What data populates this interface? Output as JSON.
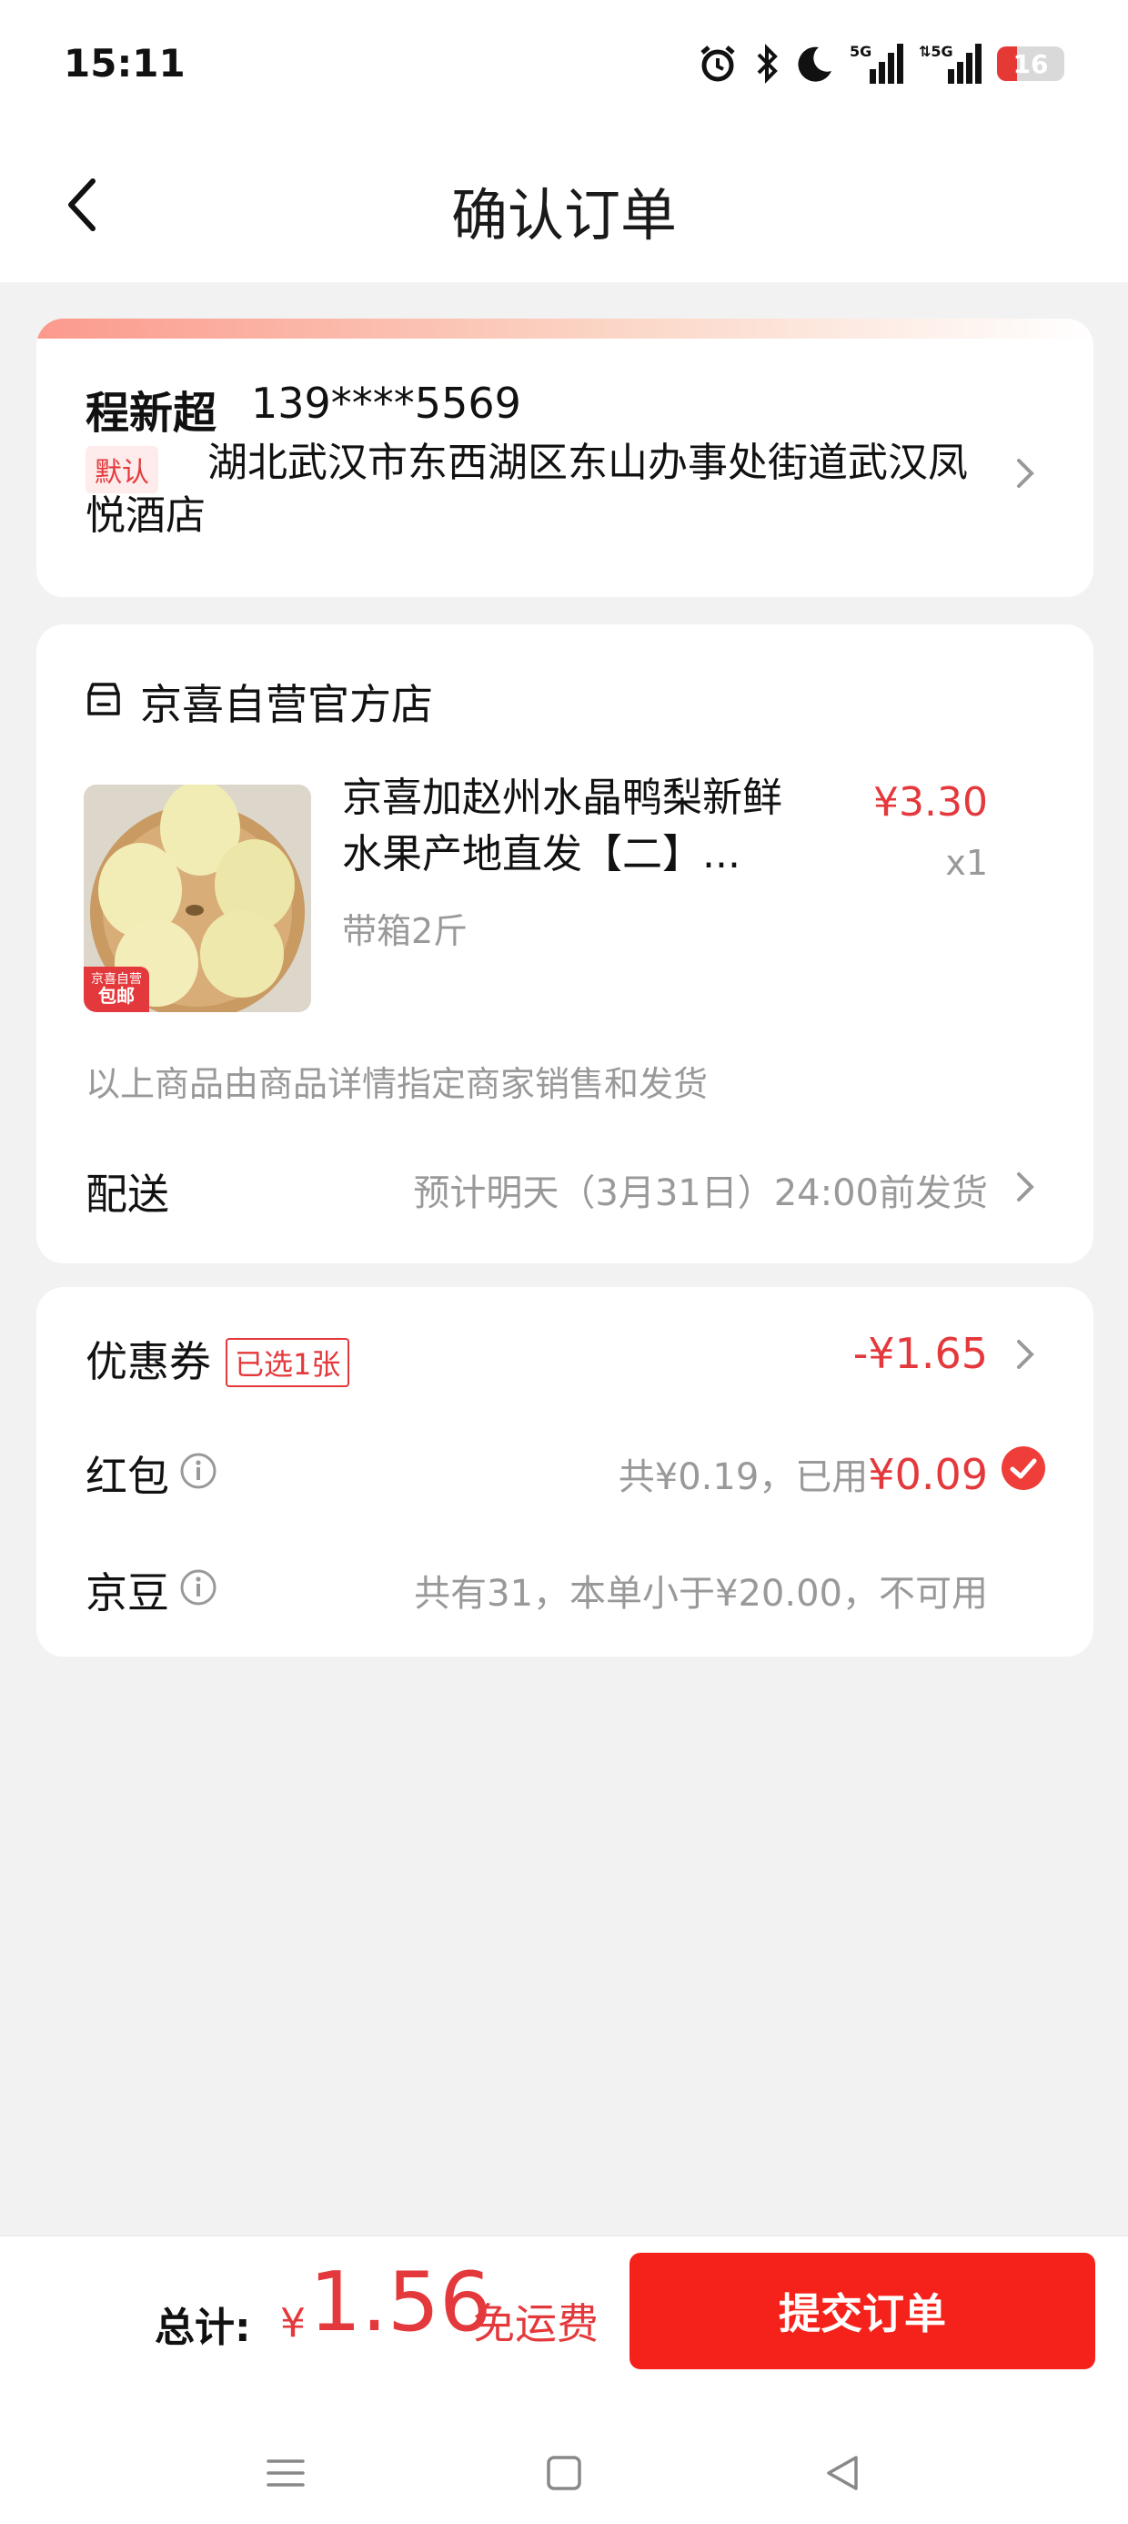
{
  "status_bar": {
    "time": "15:11",
    "battery_level": "16",
    "icons": [
      "alarm-icon",
      "bluetooth-icon",
      "do-not-disturb-icon",
      "5g-signal-icon",
      "5g-signal-icon",
      "battery-icon"
    ]
  },
  "header": {
    "title": "确认订单",
    "back_icon": "chevron-left-icon"
  },
  "address": {
    "name": "程新超",
    "phone": "139****5569",
    "default_tag": "默认",
    "detail": "湖北武汉市东西湖区东山办事处街道武汉凤悦酒店"
  },
  "order": {
    "store_name": "京喜自营官方店",
    "product": {
      "title": "京喜加赵州水晶鸭梨新鲜水果产地直发【二】...",
      "price": "¥3.30",
      "quantity": "x1",
      "spec": "带箱2斤",
      "badge_line1": "京喜自营",
      "badge_line2": "包邮"
    },
    "seller_note": "以上商品由商品详情指定商家销售和发货",
    "delivery_label": "配送",
    "delivery_value": "预计明天（3月31日）24:00前发货"
  },
  "discounts": {
    "coupon_label": "优惠券",
    "coupon_tag": "已选1张",
    "coupon_value": "-¥1.65",
    "hongbao_label": "红包",
    "hongbao_total": "共¥0.19，已用",
    "hongbao_used": "¥0.09",
    "jingdou_label": "京豆",
    "jingdou_summary": "共有31，本单小于¥20.00，不可用"
  },
  "footer": {
    "total_label": "总计:",
    "currency": "¥",
    "total_amount": "1.56",
    "free_shipping": "免运费",
    "submit_label": "提交订单"
  },
  "colors": {
    "accent": "#e4393c",
    "submit": "#f5221b",
    "background": "#f2f2f2"
  }
}
